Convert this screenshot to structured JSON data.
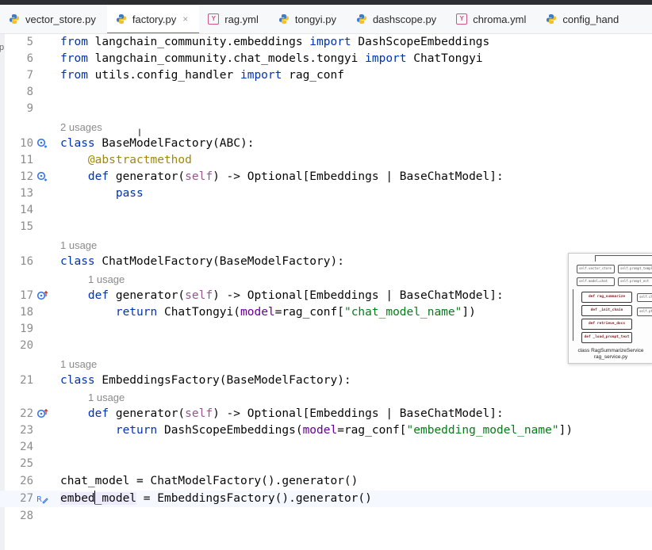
{
  "tabs": [
    {
      "label": "vector_store.py",
      "icon": "python-file-icon",
      "active": false
    },
    {
      "label": "factory.py",
      "icon": "python-file-icon",
      "active": true,
      "close": "×"
    },
    {
      "label": "rag.yml",
      "icon": "yaml-file-icon",
      "active": false
    },
    {
      "label": "tongyi.py",
      "icon": "python-file-icon",
      "active": false
    },
    {
      "label": "dashscope.py",
      "icon": "python-file-icon",
      "active": false
    },
    {
      "label": "chroma.yml",
      "icon": "yaml-file-icon",
      "active": false
    },
    {
      "label": "config_hand",
      "icon": "python-file-icon",
      "active": false
    }
  ],
  "left_strip_letter": "p",
  "usages": {
    "u2": "2 usages",
    "u1a": "1 usage",
    "u1b": "1 usage",
    "u1c": "1 usage",
    "u1d": "1 usage"
  },
  "line_numbers": {
    "l5": "5",
    "l6": "6",
    "l7": "7",
    "l8": "8",
    "l9": "9",
    "l10": "10",
    "l11": "11",
    "l12": "12",
    "l13": "13",
    "l14": "14",
    "l15": "15",
    "l16": "16",
    "l17": "17",
    "l18": "18",
    "l19": "19",
    "l20": "20",
    "l21": "21",
    "l22": "22",
    "l23": "23",
    "l24": "24",
    "l25": "25",
    "l26": "26",
    "l27": "27",
    "l28": "28"
  },
  "code": {
    "l5": {
      "a": "from",
      "b": " langchain_community.embeddings ",
      "c": "import",
      "d": " DashScopeEmbeddings"
    },
    "l6": {
      "a": "from",
      "b": " langchain_community.chat_models.tongyi ",
      "c": "import",
      "d": " ChatTongyi"
    },
    "l7": {
      "a": "from",
      "b": " utils.config_handler ",
      "c": "import",
      "d": " rag_conf"
    },
    "l10": {
      "a": "class",
      "b": " BaseModelFactory(ABC):"
    },
    "l11": {
      "a": "@abstractmethod"
    },
    "l12": {
      "a": "def",
      "b": " generator(",
      "c": "self",
      "d": ") -> Optional[Embeddings | BaseChatModel]:"
    },
    "l13": {
      "a": "pass"
    },
    "l16": {
      "a": "class",
      "b": " ChatModelFactory(BaseModelFactory):"
    },
    "l17": {
      "a": "def",
      "b": " generator(",
      "c": "self",
      "d": ") -> Optional[Embeddings | BaseChatModel]:"
    },
    "l18": {
      "a": "return",
      "b": " ChatTongyi(",
      "c": "model",
      "d": "=rag_conf[",
      "e": "\"chat_model_name\"",
      "f": "])"
    },
    "l21": {
      "a": "class",
      "b": " EmbeddingsFactory(BaseModelFactory):"
    },
    "l22": {
      "a": "def",
      "b": " generator(",
      "c": "self",
      "d": ") -> Optional[Embeddings | BaseChatModel]:"
    },
    "l23": {
      "a": "return",
      "b": " DashScopeEmbeddings(",
      "c": "model",
      "d": "=rag_conf[",
      "e": "\"embedding_model_name\"",
      "f": "])"
    },
    "l26": {
      "a": "chat_model = ChatModelFactory().generator()"
    },
    "l27": {
      "a": "embed",
      "b": "_model",
      "c": " = EmbeddingsFactory().generator()"
    }
  },
  "thumbnail": {
    "boxes": [
      "self.vector_store",
      "self.prompt_templ",
      "self.model=chat",
      "self.prompt_est"
    ],
    "methods": [
      "def rag_summarize",
      "def _init_chain",
      "def retrieve_docs",
      "def _load_prompt_text"
    ],
    "side": [
      "self.ch",
      "self.pt"
    ],
    "caption1": "class RagSummarizeService",
    "caption2": "rag_service.py"
  },
  "colors": {
    "keyword": "#0033b3",
    "decorator": "#9e880d",
    "self": "#94558d",
    "string": "#067d17",
    "param": "#660099",
    "accent": "#3574f0"
  }
}
